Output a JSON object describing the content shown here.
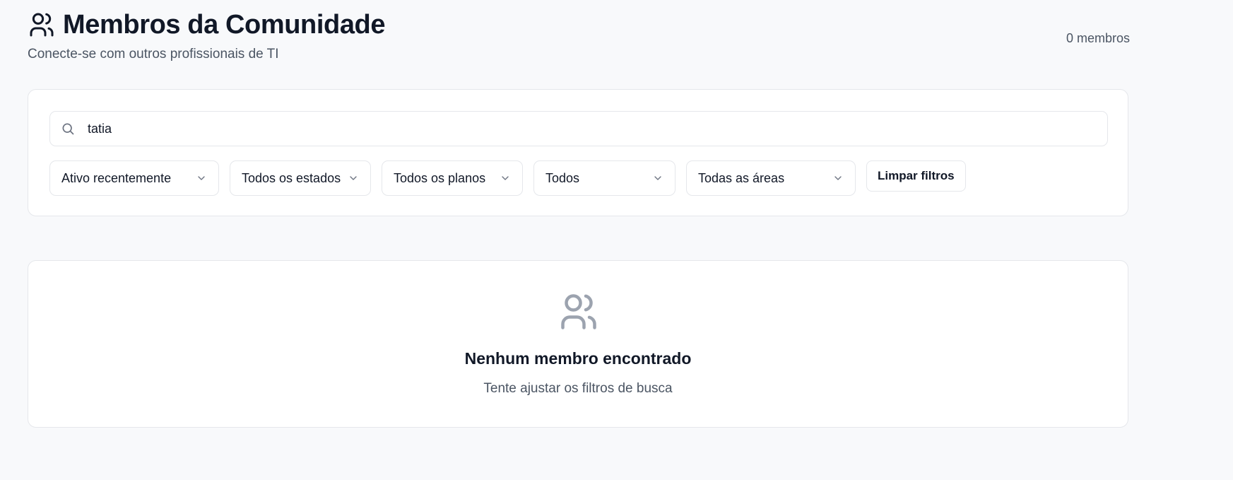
{
  "header": {
    "title": "Membros da Comunidade",
    "subtitle": "Conecte-se com outros profissionais de TI",
    "member_count": "0 membros",
    "icon": "users-icon"
  },
  "search": {
    "value": "tatia",
    "icon": "search-icon"
  },
  "filters": {
    "activity": "Ativo recentemente",
    "state": "Todos os estados",
    "plan": "Todos os planos",
    "type": "Todos",
    "area": "Todas as áreas",
    "clear_label": "Limpar filtros"
  },
  "empty_state": {
    "icon": "users-icon",
    "title": "Nenhum membro encontrado",
    "text": "Tente ajustar os filtros de busca"
  },
  "colors": {
    "background": "#f8f9fb",
    "card": "#ffffff",
    "border": "#e5e7eb",
    "text_primary": "#111827",
    "text_secondary": "#4b5563",
    "icon_muted": "#9ca3af"
  }
}
